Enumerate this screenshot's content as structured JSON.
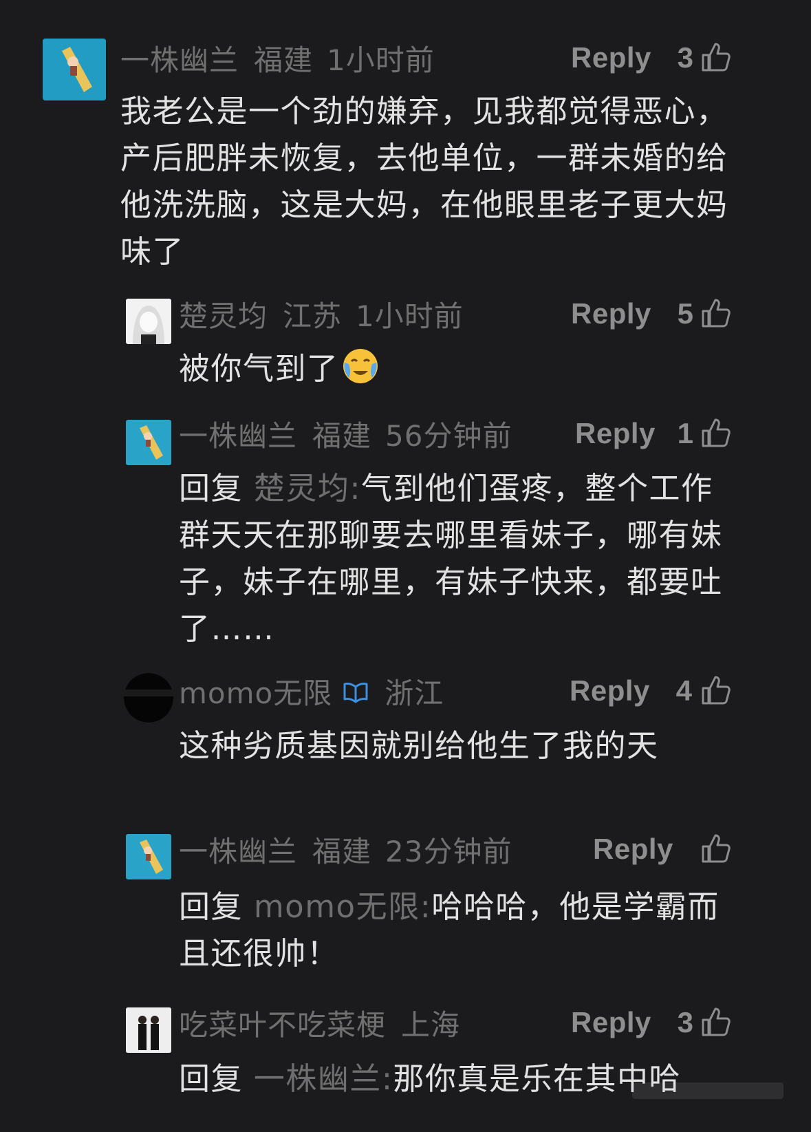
{
  "reply_label": "Reply",
  "colors": {
    "background": "#1b1b1d",
    "meta_text": "#707070",
    "body_text": "#e2e2e2",
    "verify_badge": "#3d8fe0"
  },
  "comments": [
    {
      "user": "一株幽兰",
      "location": "福建",
      "time": "1小时前",
      "likes": "3",
      "avatar": "cartoon-avatar",
      "body_lines": [
        "我老公是一个劲的嫌弃，见我都觉得恶心，",
        "产后肥胖未恢复，去他单位，一群未婚的给",
        "他洗洗脑，这是大妈，在他眼里老子更大妈",
        "味了"
      ]
    },
    {
      "user": "楚灵均",
      "location": "江苏",
      "time": "1小时前",
      "likes": "5",
      "avatar": "anime-girl-avatar",
      "body_text": "被你气到了",
      "emoji": "crying-face-emoji"
    },
    {
      "user": "一株幽兰",
      "location": "福建",
      "time": "56分钟前",
      "likes": "1",
      "avatar": "cartoon-avatar",
      "reply_prefix": "回复",
      "reply_to": "楚灵均:",
      "body_lines": [
        "气到他们蛋疼，整个工作",
        "群天天在那聊要去哪里看妹子，哪有妹",
        "子，妹子在哪里，有妹子快来，都要吐",
        "了……"
      ]
    },
    {
      "user": "momo无限",
      "location": "浙江",
      "time": "",
      "likes": "4",
      "avatar": "black-circle-avatar",
      "verified": "verified-badge-icon",
      "body_text": "这种劣质基因就别给他生了我的天"
    },
    {
      "user": "一株幽兰",
      "location": "福建",
      "time": "23分钟前",
      "likes": "",
      "avatar": "cartoon-avatar",
      "reply_prefix": "回复",
      "reply_to": "momo无限:",
      "body_lines": [
        "哈哈哈，他是学霸而",
        "且还很帅！"
      ]
    },
    {
      "user": "吃菜叶不吃菜梗",
      "location": "上海",
      "time": "",
      "likes": "3",
      "avatar": "photo-avatar",
      "reply_prefix": "回复",
      "reply_to": "一株幽兰:",
      "body_text": "那你真是乐在其中哈"
    }
  ]
}
